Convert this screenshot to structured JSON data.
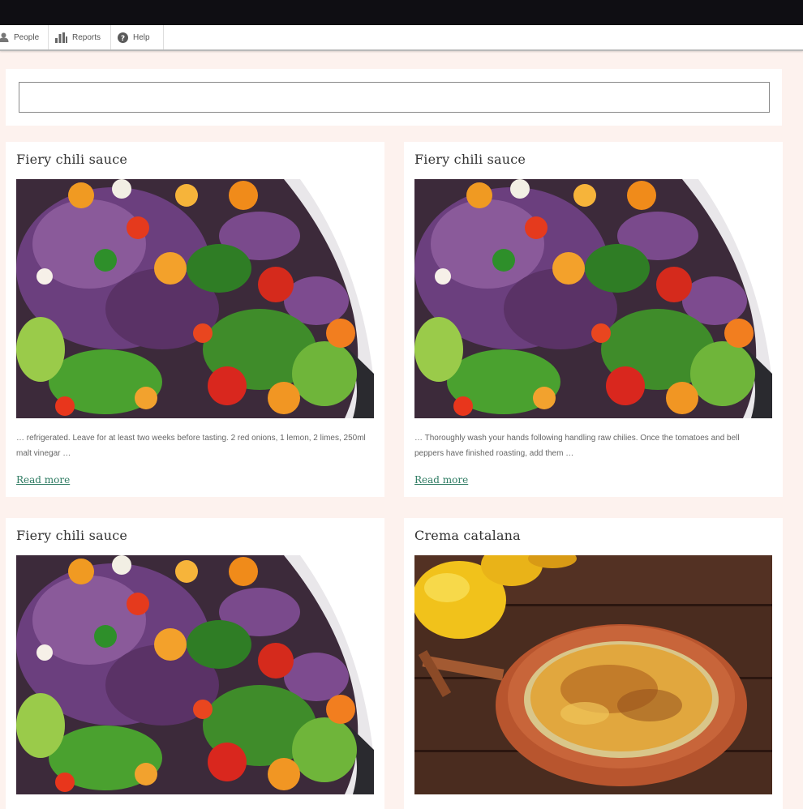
{
  "toolbar": {
    "items": [
      {
        "label": "People",
        "icon": "person-icon"
      },
      {
        "label": "Reports",
        "icon": "bar-chart-icon"
      },
      {
        "label": "Help",
        "icon": "help-icon"
      }
    ]
  },
  "search": {
    "value": "",
    "placeholder": ""
  },
  "cards": [
    {
      "title": "Fiery chili sauce",
      "image": "chili-sauce-image",
      "excerpt": "… refrigerated. Leave for at least two weeks before tasting. 2 red onions, 1 lemon, 2 limes, 250ml malt vinegar …",
      "link": "Read more"
    },
    {
      "title": "Fiery chili sauce",
      "image": "chili-sauce-image",
      "excerpt": "… Thoroughly wash your hands following handling raw chilies. Once the tomatoes and bell peppers have finished roasting, add them …",
      "link": "Read more"
    },
    {
      "title": "Fiery chili sauce",
      "image": "chili-sauce-image"
    },
    {
      "title": "Crema catalana",
      "image": "crema-catalana-image"
    }
  ],
  "colors": {
    "topbar": "#0f0e13",
    "page_background": "#fdf2ee",
    "link": "#2f7c63"
  }
}
